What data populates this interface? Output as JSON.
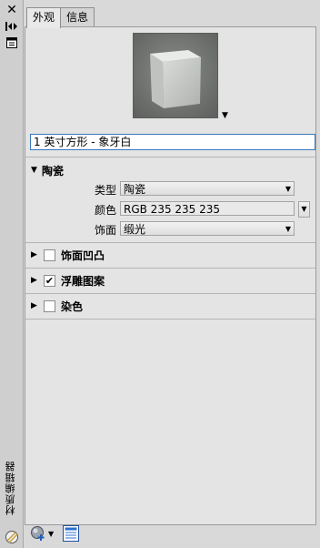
{
  "sidebar": {
    "title": "材质编辑器",
    "icons": [
      "close-icon",
      "auto-hide-icon",
      "properties-icon"
    ]
  },
  "tabs": [
    {
      "label": "外观",
      "active": true
    },
    {
      "label": "信息",
      "active": false
    }
  ],
  "material": {
    "name": "1 英寸方形 - 象牙白"
  },
  "sections": {
    "ceramic": {
      "label": "陶瓷",
      "expanded": true,
      "properties": {
        "type_label": "类型",
        "type_value": "陶瓷",
        "color_label": "颜色",
        "color_value": "RGB 235 235 235",
        "finish_label": "饰面",
        "finish_value": "缎光"
      }
    },
    "finish_bumps": {
      "label": "饰面凹凸",
      "checked": false
    },
    "relief_pattern": {
      "label": "浮雕图案",
      "checked": true
    },
    "tint": {
      "label": "染色",
      "checked": false
    }
  },
  "colors": {
    "focus_border": "#3a76b9",
    "panel_bg": "#e4e4e4"
  }
}
